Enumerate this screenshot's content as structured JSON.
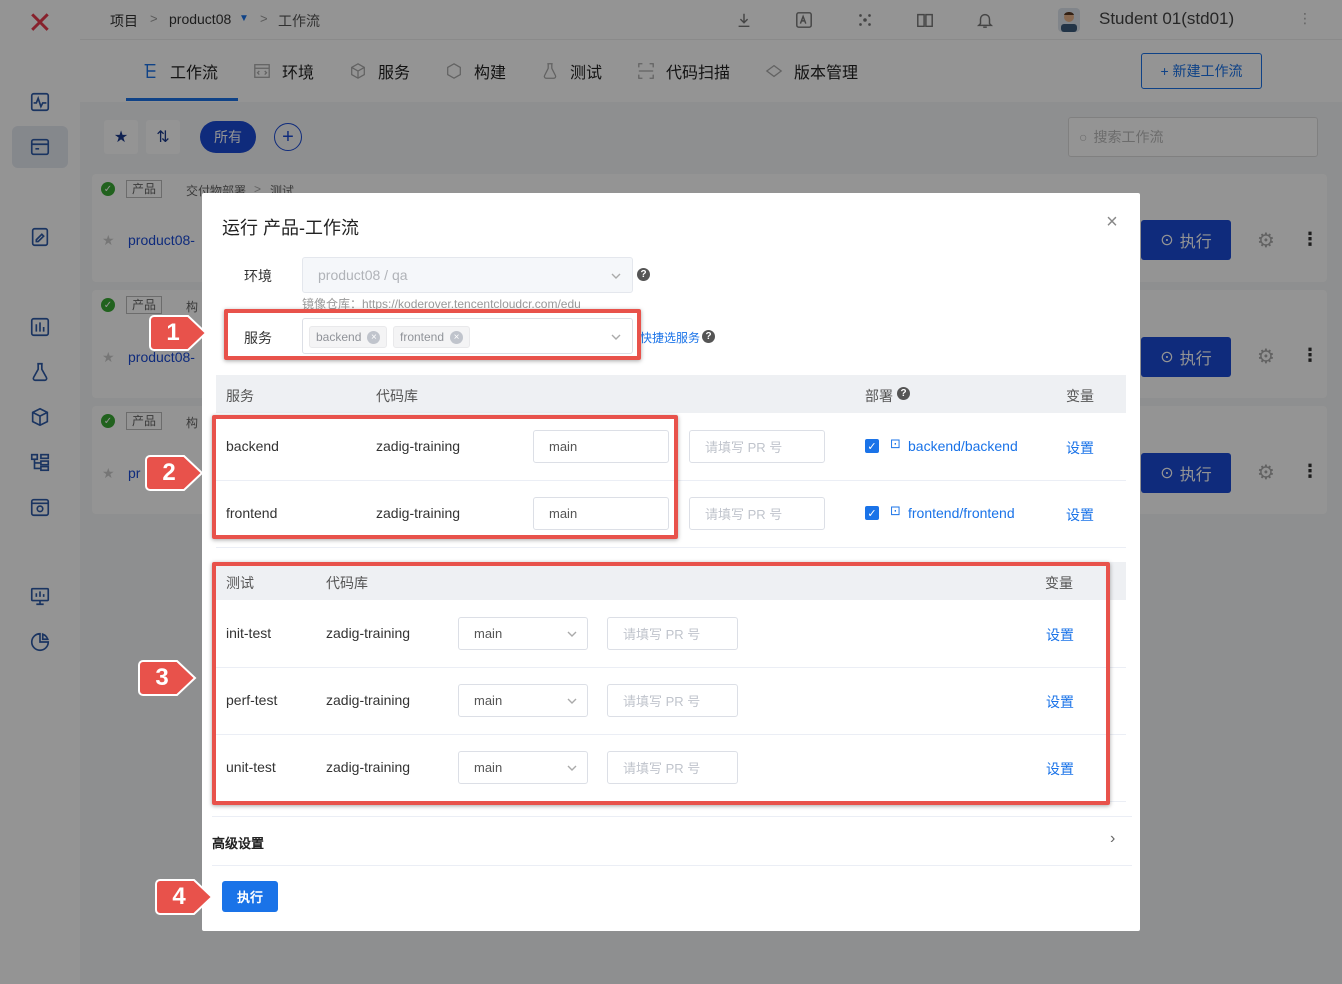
{
  "breadcrumb": {
    "project": "项目",
    "product": "product08",
    "page": "工作流"
  },
  "user": {
    "name": "Student 01(std01)"
  },
  "tabs": [
    "工作流",
    "环境",
    "服务",
    "构建",
    "测试",
    "代码扫描",
    "版本管理"
  ],
  "new_workflow_button": "+ 新建工作流",
  "filters": {
    "all_label": "所有",
    "search_placeholder": "搜索工作流"
  },
  "cards": [
    {
      "tag": "产品",
      "stages": [
        "交付物部署",
        "测试"
      ],
      "name": "product08-",
      "exec": "执行"
    },
    {
      "tag": "产品",
      "stages": [
        "构"
      ],
      "name": "product08-",
      "exec": "执行"
    },
    {
      "tag": "产品",
      "stages": [
        "构"
      ],
      "name": "pr",
      "exec": "执行"
    }
  ],
  "modal": {
    "title": "运行 产品-工作流",
    "env_label": "环境",
    "env_value": "product08 / qa",
    "registry_text": "镜像仓库：https://koderover.tencentcloudcr.com/edu",
    "service_label": "服务",
    "service_tags": [
      "backend",
      "frontend"
    ],
    "quick_select": "快捷选服务",
    "build_table": {
      "headers": {
        "service": "服务",
        "repo": "代码库",
        "deploy": "部署",
        "vars": "变量"
      },
      "rows": [
        {
          "service": "backend",
          "repo": "zadig-training",
          "branch": "main",
          "pr_placeholder": "请填写 PR 号",
          "deploy": "backend/backend",
          "settings": "设置"
        },
        {
          "service": "frontend",
          "repo": "zadig-training",
          "branch": "main",
          "pr_placeholder": "请填写 PR 号",
          "deploy": "frontend/frontend",
          "settings": "设置"
        }
      ]
    },
    "test_table": {
      "headers": {
        "test": "测试",
        "repo": "代码库",
        "vars": "变量"
      },
      "rows": [
        {
          "test": "init-test",
          "repo": "zadig-training",
          "branch": "main",
          "pr_placeholder": "请填写 PR 号",
          "settings": "设置"
        },
        {
          "test": "perf-test",
          "repo": "zadig-training",
          "branch": "main",
          "pr_placeholder": "请填写 PR 号",
          "settings": "设置"
        },
        {
          "test": "unit-test",
          "repo": "zadig-training",
          "branch": "main",
          "pr_placeholder": "请填写 PR 号",
          "settings": "设置"
        }
      ]
    },
    "advanced_label": "高级设置",
    "run_button": "执行"
  },
  "annotations": [
    "1",
    "2",
    "3",
    "4"
  ],
  "colors": {
    "primary": "#1a73e8",
    "annotation_red": "#e8524b",
    "logo_red": "#e8394d"
  }
}
